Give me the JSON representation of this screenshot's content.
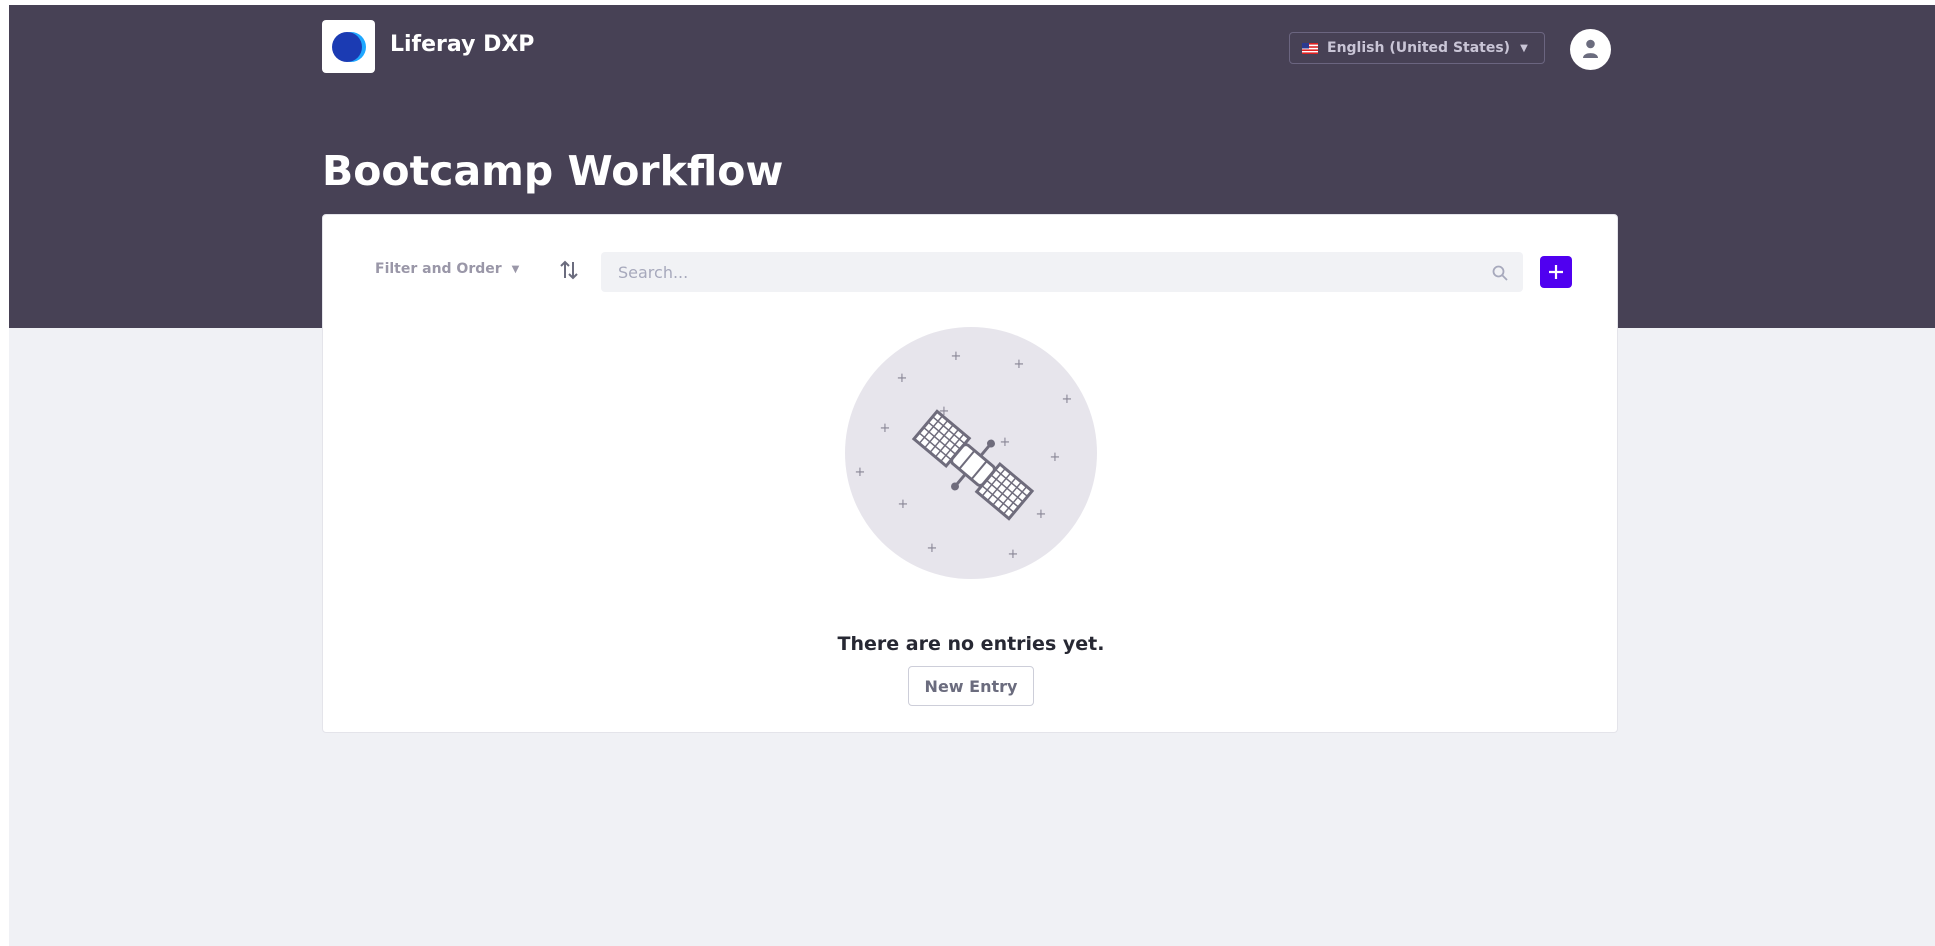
{
  "header": {
    "site_title": "Liferay DXP",
    "logo_icon": "liferay-logo-icon",
    "language": {
      "flag_icon": "us-flag-icon",
      "label": "English (United States)",
      "caret_icon": "caret-down-icon"
    },
    "avatar_icon": "user-icon"
  },
  "page": {
    "title": "Bootcamp Workflow"
  },
  "toolbar": {
    "filter_label": "Filter and Order",
    "filter_caret_icon": "caret-down-icon",
    "sort_icon": "order-arrows-icon",
    "search_placeholder": "Search...",
    "search_icon": "search-icon",
    "add_icon": "plus-icon"
  },
  "empty_state": {
    "illustration": "satellite-illustration",
    "message": "There are no entries yet.",
    "button_label": "New Entry"
  },
  "colors": {
    "header_bg": "#474155",
    "page_bg": "#f0f1f5",
    "primary": "#5000f0",
    "title_text": "#272833"
  }
}
